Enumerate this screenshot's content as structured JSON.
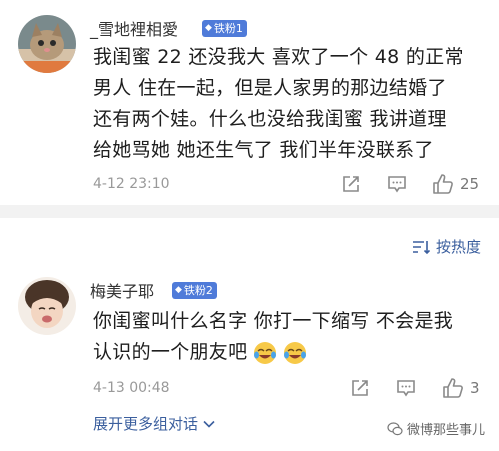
{
  "comments": [
    {
      "username": "_雪地裡相愛",
      "badge": "铁粉1",
      "lines": [
        "我闺蜜 22 还没我大 喜欢了一个 48 的正常",
        "男人 住在一起，但是人家男的那边结婚了",
        "还有两个娃。什么也没给我闺蜜 我讲道理",
        "给她骂她 她还生气了 我们半年没联系了"
      ],
      "time": "4-12 23:10",
      "likes": "25"
    },
    {
      "username": "梅美子耶",
      "badge": "铁粉2",
      "lines": [
        "你闺蜜叫什么名字 你打一下缩写 不会是我",
        "认识的一个朋友吧"
      ],
      "time": "4-13 00:48",
      "likes": "3"
    }
  ],
  "sort": {
    "label": "按热度"
  },
  "expand": {
    "label": "展开更多组对话"
  },
  "watermark": {
    "label": "微博那些事儿"
  },
  "icons": {
    "share": "share-icon",
    "comment": "comment-icon",
    "like": "thumbs-up-icon",
    "emoji": "crying-laughing-emoji"
  },
  "colors": {
    "link": "#3b5f9e",
    "badge": "#4f7bd9",
    "divider": "#f2f2f2"
  }
}
